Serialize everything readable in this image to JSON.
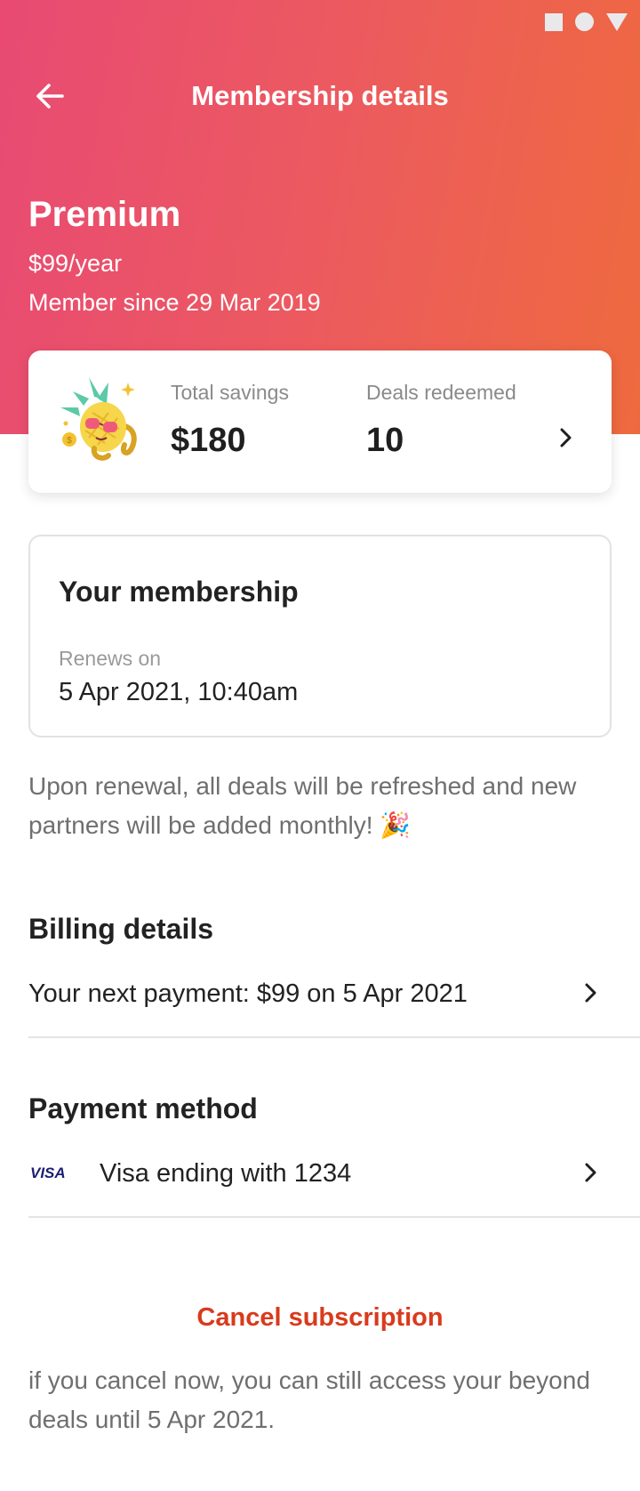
{
  "header": {
    "title": "Membership details"
  },
  "plan": {
    "name": "Premium",
    "price": "$99/year",
    "member_since": "Member since 29 Mar 2019"
  },
  "stats": {
    "savings_label": "Total savings",
    "savings_value": "$180",
    "deals_label": "Deals redeemed",
    "deals_value": "10"
  },
  "membership": {
    "title": "Your membership",
    "renews_label": "Renews on",
    "renews_value": "5 Apr 2021, 10:40am"
  },
  "renewal_note": "Upon renewal, all deals will be refreshed and new partners will be added monthly! 🎉",
  "billing": {
    "title": "Billing details",
    "next_payment": "Your next payment: $99 on 5 Apr 2021"
  },
  "payment": {
    "title": "Payment method",
    "card_brand": "VISA",
    "card_text": "Visa ending with 1234"
  },
  "cancel": {
    "label": "Cancel subscription",
    "note": "if you cancel now, you can still access your beyond deals until 5 Apr 2021."
  },
  "colors": {
    "gradient_start": "#e84a73",
    "gradient_end": "#ee6a3e",
    "cancel_red": "#d93a1c"
  },
  "icons": {
    "back": "arrow-left-icon",
    "chevron": "chevron-right-icon",
    "mascot": "pineapple-mascot-icon",
    "visa": "visa-logo-icon"
  }
}
